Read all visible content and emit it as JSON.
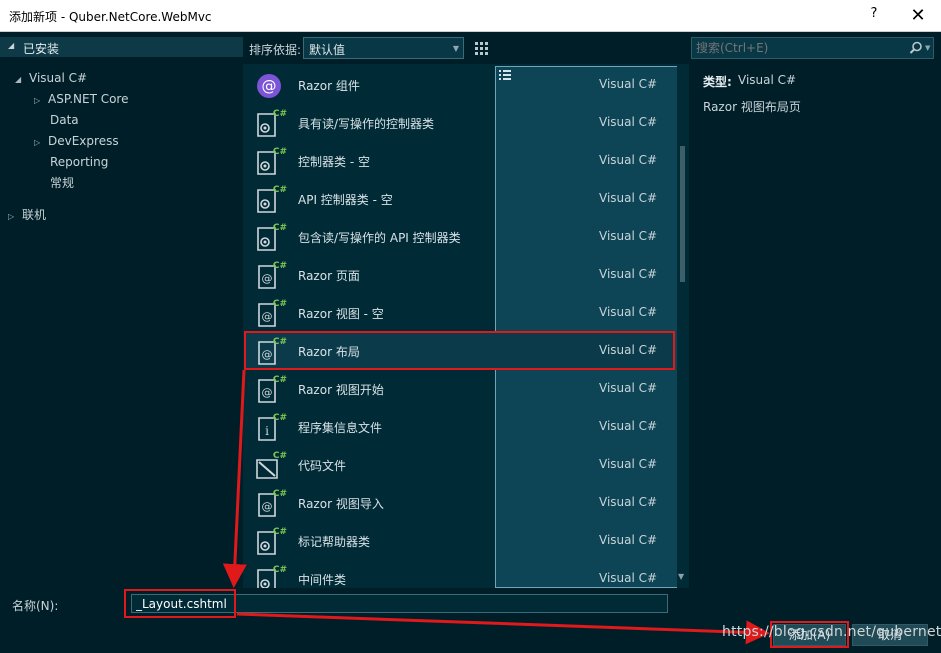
{
  "window": {
    "title": "添加新项 - Quber.NetCore.WebMvc",
    "help_label": "?",
    "close_label": "✕"
  },
  "left": {
    "header": "已安装",
    "tree": [
      {
        "label": "Visual C#",
        "expanded": true
      },
      {
        "label": "ASP.NET Core",
        "expanded": false
      },
      {
        "label": "Data"
      },
      {
        "label": "DevExpress",
        "expanded": false
      },
      {
        "label": "Reporting"
      },
      {
        "label": "常规"
      },
      {
        "label": "联机",
        "expanded": false
      }
    ]
  },
  "toolbar": {
    "sort_label": "排序依据:",
    "sort_value": "默认值"
  },
  "templates": [
    {
      "name": "Razor 组件",
      "lang": "Visual C#",
      "icon": "razor-component-icon"
    },
    {
      "name": "具有读/写操作的控制器类",
      "lang": "Visual C#",
      "icon": "controller-icon"
    },
    {
      "name": "控制器类 - 空",
      "lang": "Visual C#",
      "icon": "controller-icon"
    },
    {
      "name": "API 控制器类 - 空",
      "lang": "Visual C#",
      "icon": "controller-icon"
    },
    {
      "name": "包含读/写操作的 API 控制器类",
      "lang": "Visual C#",
      "icon": "controller-icon"
    },
    {
      "name": "Razor 页面",
      "lang": "Visual C#",
      "icon": "razor-page-icon"
    },
    {
      "name": "Razor 视图 - 空",
      "lang": "Visual C#",
      "icon": "razor-page-icon"
    },
    {
      "name": "Razor 布局",
      "lang": "Visual C#",
      "icon": "razor-page-icon",
      "selected": true
    },
    {
      "name": "Razor 视图开始",
      "lang": "Visual C#",
      "icon": "razor-page-icon"
    },
    {
      "name": "程序集信息文件",
      "lang": "Visual C#",
      "icon": "info-file-icon"
    },
    {
      "name": "代码文件",
      "lang": "Visual C#",
      "icon": "code-file-icon"
    },
    {
      "name": "Razor 视图导入",
      "lang": "Visual C#",
      "icon": "razor-page-icon"
    },
    {
      "name": "标记帮助器类",
      "lang": "Visual C#",
      "icon": "controller-icon"
    },
    {
      "name": "中间件类",
      "lang": "Visual C#",
      "icon": "controller-icon"
    }
  ],
  "search": {
    "placeholder": "搜索(Ctrl+E)"
  },
  "details": {
    "type_label": "类型:",
    "type_value": "Visual C#",
    "description": "Razor 视图布局页"
  },
  "footer": {
    "name_label": "名称(N):",
    "name_value": "_Layout.cshtml",
    "add_label": "添加(A)",
    "cancel_label": "取消"
  },
  "watermark": "https://blog.csdn.net/qubernet",
  "colors": {
    "background": "#001e28",
    "list_background": "#002a36",
    "selection": "#0b3b4a",
    "annotation_red": "#e0191b",
    "csharp_green": "#7ec850"
  }
}
